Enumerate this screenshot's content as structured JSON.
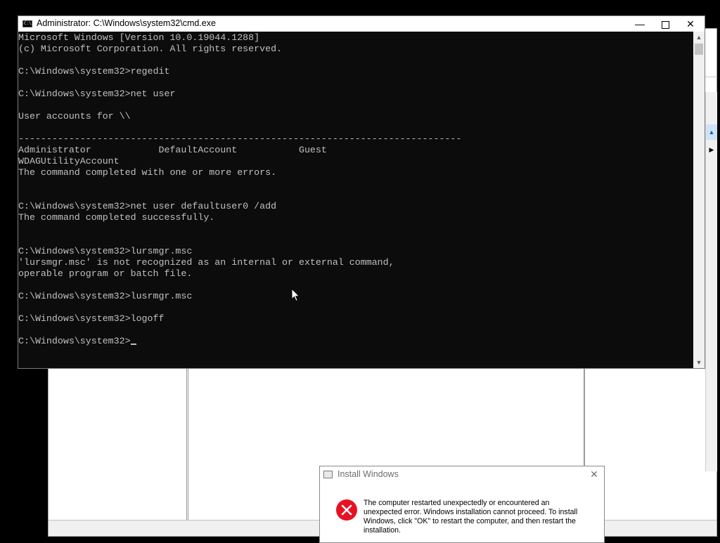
{
  "cmd_window": {
    "title": "Administrator: C:\\Windows\\system32\\cmd.exe",
    "icon": "cmd-icon",
    "console_lines": [
      "Microsoft Windows [Version 10.0.19044.1288]",
      "(c) Microsoft Corporation. All rights reserved.",
      "",
      "C:\\Windows\\system32>regedit",
      "",
      "C:\\Windows\\system32>net user",
      "",
      "User accounts for \\\\",
      "",
      "-------------------------------------------------------------------------------",
      "Administrator            DefaultAccount           Guest",
      "WDAGUtilityAccount",
      "The command completed with one or more errors.",
      "",
      "",
      "C:\\Windows\\system32>net user defaultuser0 /add",
      "The command completed successfully.",
      "",
      "",
      "C:\\Windows\\system32>lursmgr.msc",
      "'lursmgr.msc' is not recognized as an internal or external command,",
      "operable program or batch file.",
      "",
      "C:\\Windows\\system32>lusrmgr.msc",
      "",
      "C:\\Windows\\system32>logoff",
      ""
    ],
    "prompt": "C:\\Windows\\system32>",
    "colors": {
      "console_bg": "#0c0c0c",
      "console_text": "#c0c0c0",
      "titlebar_bg": "#ffffff"
    }
  },
  "dialog": {
    "title": "Install Windows",
    "message": "The computer restarted unexpectedly or encountered an unexpected error. Windows installation cannot proceed. To install Windows, click \"OK\" to restart the computer, and then restart the installation.",
    "icon": "error-icon",
    "colors": {
      "error_red": "#e81123"
    }
  }
}
